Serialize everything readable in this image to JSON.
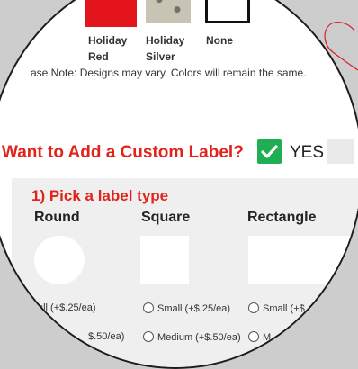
{
  "colors": {
    "accent_red": "#e2231a",
    "check_green": "#1fae54",
    "panel_bg": "#efefef"
  },
  "design_options": [
    {
      "line1": "Holiday",
      "line2": "Red"
    },
    {
      "line1": "Holiday",
      "line2": "Silver"
    },
    {
      "line1": "None",
      "line2": ""
    }
  ],
  "note": "ase Note: Designs may vary. Colors will remain the same.",
  "custom_label": {
    "question": "Want to Add a Custom Label?",
    "yes_label": "YES"
  },
  "label_type": {
    "heading": "1) Pick a label type",
    "types": [
      "Round",
      "Square",
      "Rectangle"
    ]
  },
  "sizes": {
    "round_small": "all (+$.25/ea)",
    "square_small": "Small (+$.25/ea)",
    "rect_small": "Small (+$",
    "round_medium": "$.50/ea)",
    "square_medium": "Medium (+$.50/ea)",
    "rect_medium": "M"
  }
}
